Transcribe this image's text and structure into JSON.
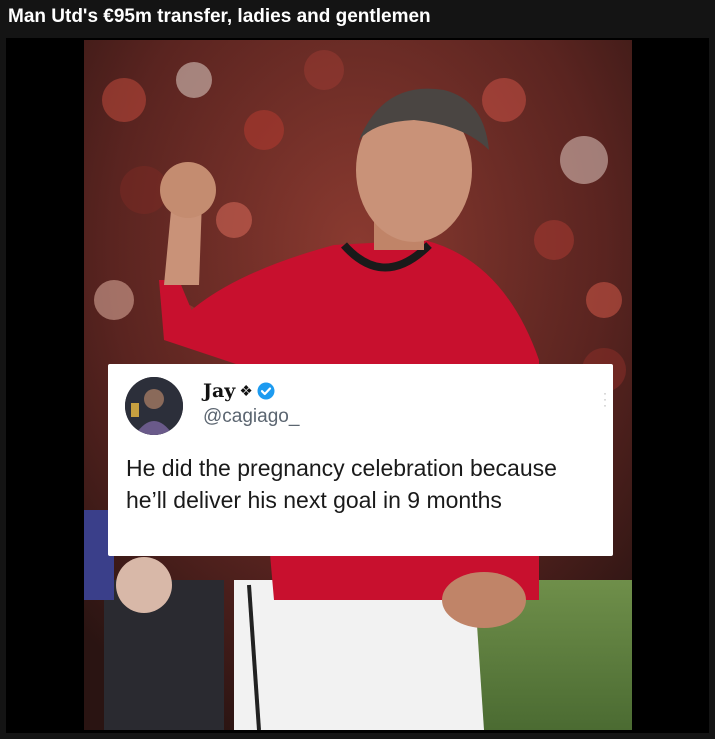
{
  "post": {
    "title": "Man Utd's €95m transfer, ladies and gentlemen"
  },
  "tweet": {
    "display_name": "Jay",
    "handle": "@cagiago_",
    "text": "He did the pregnancy celebration because he’ll deliver his next goal in 9 months",
    "badges": [
      "diamond-icon",
      "verified-icon"
    ],
    "verified_color": "#1d9bf0"
  },
  "photo": {
    "subject": "footballer-celebration-photo",
    "kit_color": "#c8102e"
  }
}
